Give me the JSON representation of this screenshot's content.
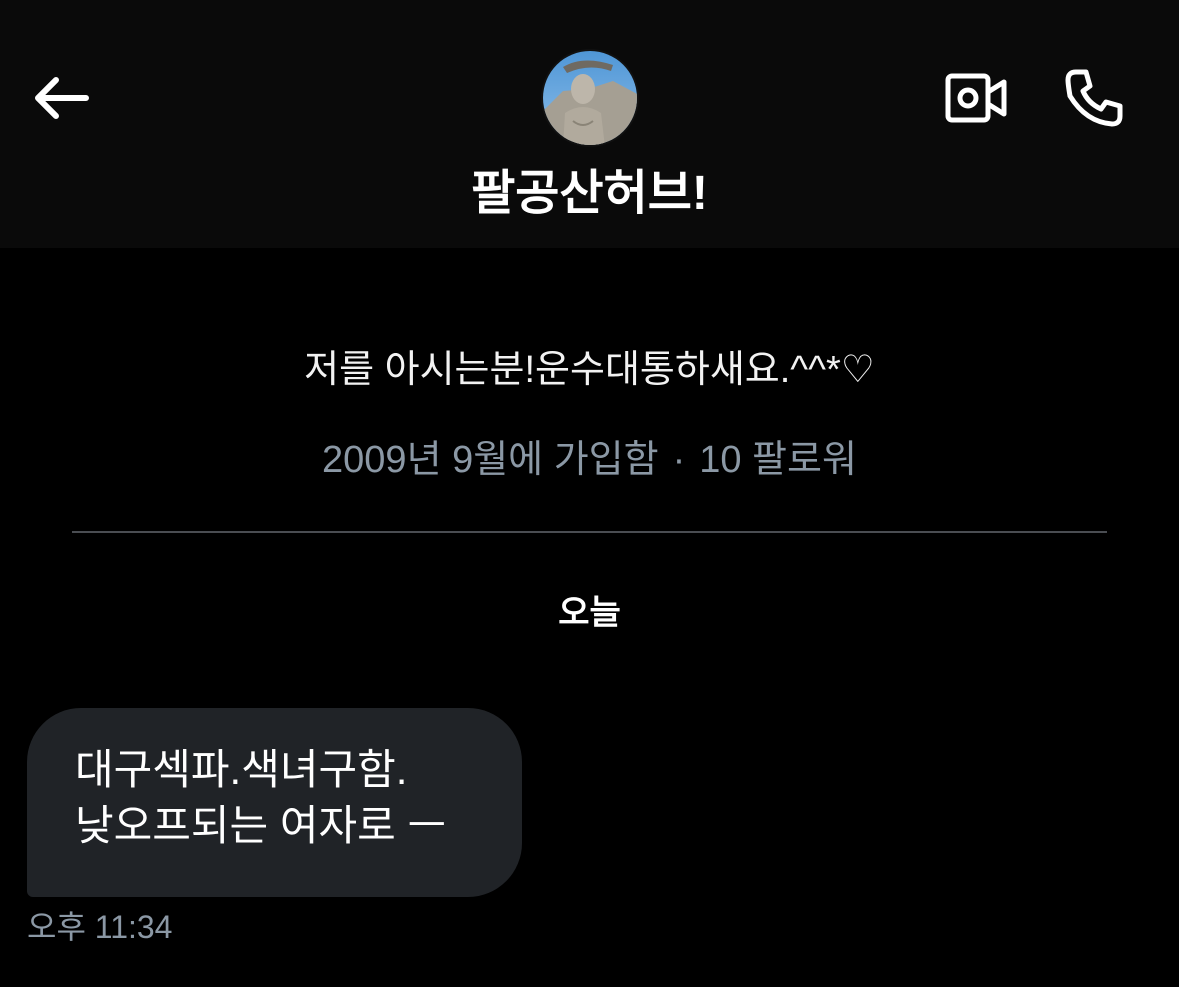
{
  "header": {
    "title": "팔공산허브!",
    "back_icon": "arrow-left-icon",
    "video_icon": "video-call-icon",
    "phone_icon": "phone-icon"
  },
  "profile": {
    "bio": "저를 아시는분!운수대통하새요.^^*♡",
    "joined": "2009년 9월에 가입함",
    "separator": "·",
    "followers": "10 팔로워"
  },
  "conversation": {
    "date_label": "오늘",
    "messages": [
      {
        "lines": [
          "대구섹파.색녀구함.",
          "낮오프되는 여자로 ㅡ"
        ],
        "time": "오후 11:34"
      }
    ]
  },
  "colors": {
    "background": "#000000",
    "header_background": "#0a0a0a",
    "bubble_background": "#202327",
    "muted_text": "#8b98a5",
    "divider": "#4a4d52"
  }
}
